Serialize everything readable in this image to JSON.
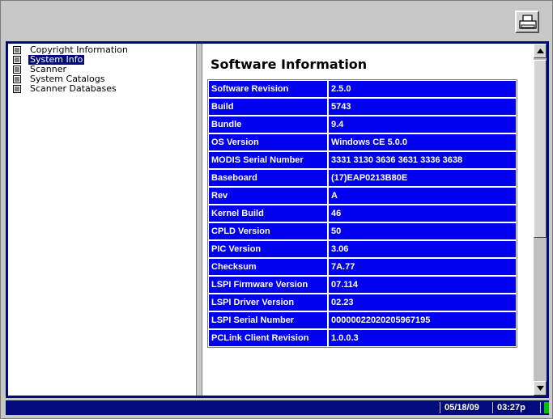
{
  "tree": {
    "items": [
      {
        "label": "Copyright Information",
        "icon": "document-icon",
        "selected": false
      },
      {
        "label": "System Info",
        "icon": "document-icon",
        "selected": true
      },
      {
        "label": "Scanner",
        "icon": "document-icon",
        "selected": false
      },
      {
        "label": "System Catalogs",
        "icon": "document-icon",
        "selected": false
      },
      {
        "label": "Scanner Databases",
        "icon": "document-icon",
        "selected": false
      }
    ]
  },
  "toolbar": {
    "print_icon": "printer-icon"
  },
  "pane": {
    "title": "Software Information",
    "rows": [
      {
        "key": "Software Revision",
        "value": "2.5.0"
      },
      {
        "key": "Build",
        "value": "5743"
      },
      {
        "key": "Bundle",
        "value": "9.4"
      },
      {
        "key": "OS Version",
        "value": "Windows CE 5.0.0"
      },
      {
        "key": "MODIS Serial Number",
        "value": "3331 3130 3636 3631 3336 3638"
      },
      {
        "key": "Baseboard",
        "value": "(17)EAP0213B80E"
      },
      {
        "key": "Rev",
        "value": "A"
      },
      {
        "key": "Kernel Build",
        "value": "46"
      },
      {
        "key": "CPLD Version",
        "value": "50"
      },
      {
        "key": "PIC Version",
        "value": "3.06"
      },
      {
        "key": "Checksum",
        "value": "7A.77"
      },
      {
        "key": "LSPI Firmware Version",
        "value": "07.114"
      },
      {
        "key": "LSPI Driver Version",
        "value": "02.23"
      },
      {
        "key": "LSPI Serial Number",
        "value": "00000022020205967195"
      },
      {
        "key": "PCLink Client Revision",
        "value": "1.0.0.3"
      }
    ]
  },
  "status": {
    "date": "05/18/09",
    "time": "03:27p"
  },
  "colors": {
    "accent": "#000a7a",
    "table_cell": "#0000ee",
    "indicator": "#00c000"
  }
}
